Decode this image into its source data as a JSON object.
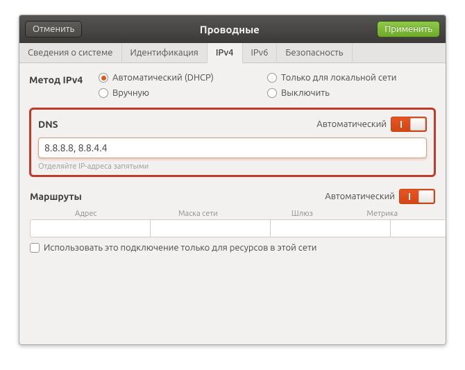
{
  "header": {
    "cancel": "Отменить",
    "title": "Проводные",
    "apply": "Применить"
  },
  "tabs": {
    "details": "Сведения о системе",
    "identity": "Идентификация",
    "ipv4": "IPv4",
    "ipv6": "IPv6",
    "security": "Безопасность"
  },
  "method": {
    "label": "Метод IPv4",
    "auto": "Автоматический (DHCP)",
    "local": "Только для локальной сети",
    "manual": "Вручную",
    "off": "Выключить"
  },
  "dns": {
    "title": "DNS",
    "auto_label": "Автоматический",
    "value": "8.8.8.8, 8.8.4.4",
    "hint": "Отделяйте IP-адреса запятыми"
  },
  "routes": {
    "title": "Маршруты",
    "auto_label": "Автоматический",
    "cols": {
      "address": "Адрес",
      "netmask": "Маска сети",
      "gateway": "Шлюз",
      "metric": "Метрика"
    },
    "only_local": "Использовать это подключение только для ресурсов в этой сети"
  }
}
